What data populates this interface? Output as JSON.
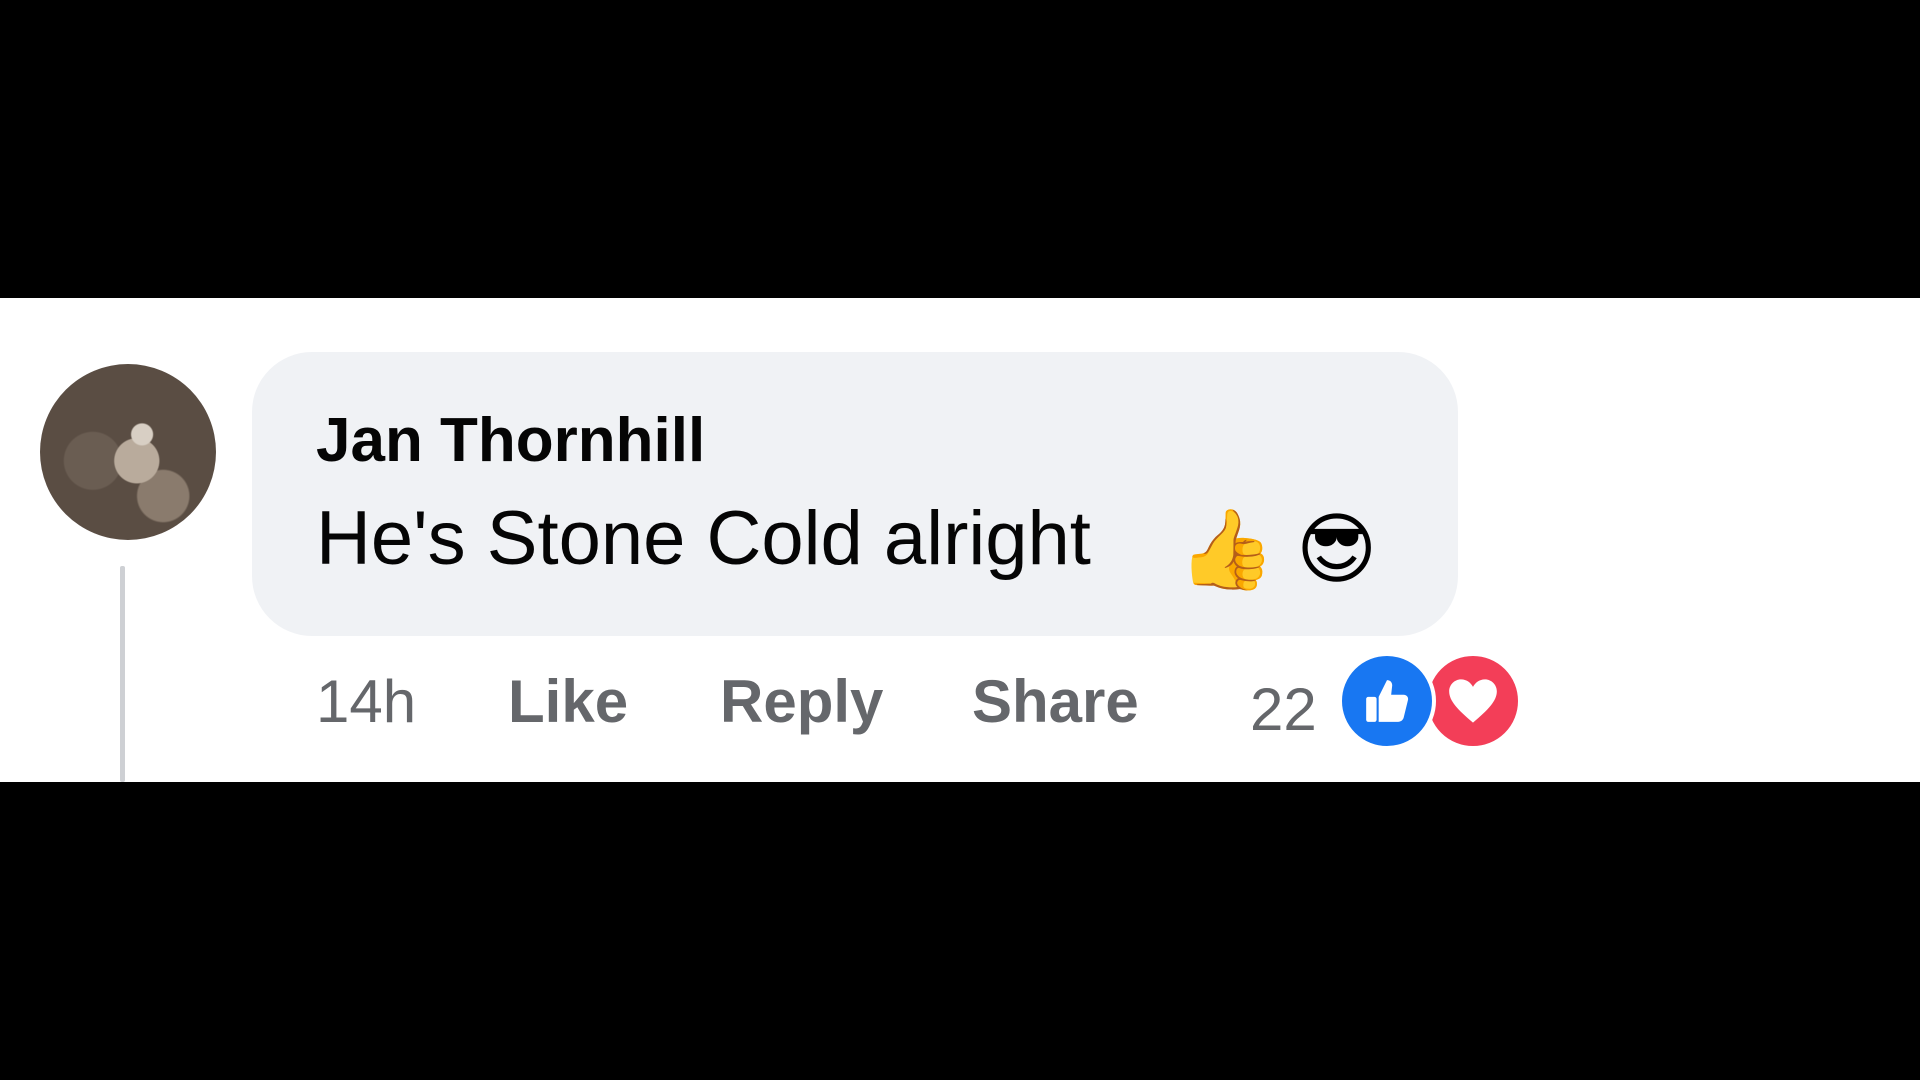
{
  "comment": {
    "author": "Jan Thornhill",
    "text": "He's Stone Cold alright",
    "emojis": [
      "👍",
      "😎"
    ],
    "time": "14h",
    "actions": {
      "like": "Like",
      "reply": "Reply",
      "share": "Share"
    },
    "reactions": {
      "count": "22",
      "types": [
        "like-icon",
        "heart-icon"
      ]
    }
  },
  "colors": {
    "bubble": "#f0f2f5",
    "text": "#050505",
    "muted": "#65676b",
    "like_blue": "#1877f2",
    "love_red": "#f33e58"
  }
}
